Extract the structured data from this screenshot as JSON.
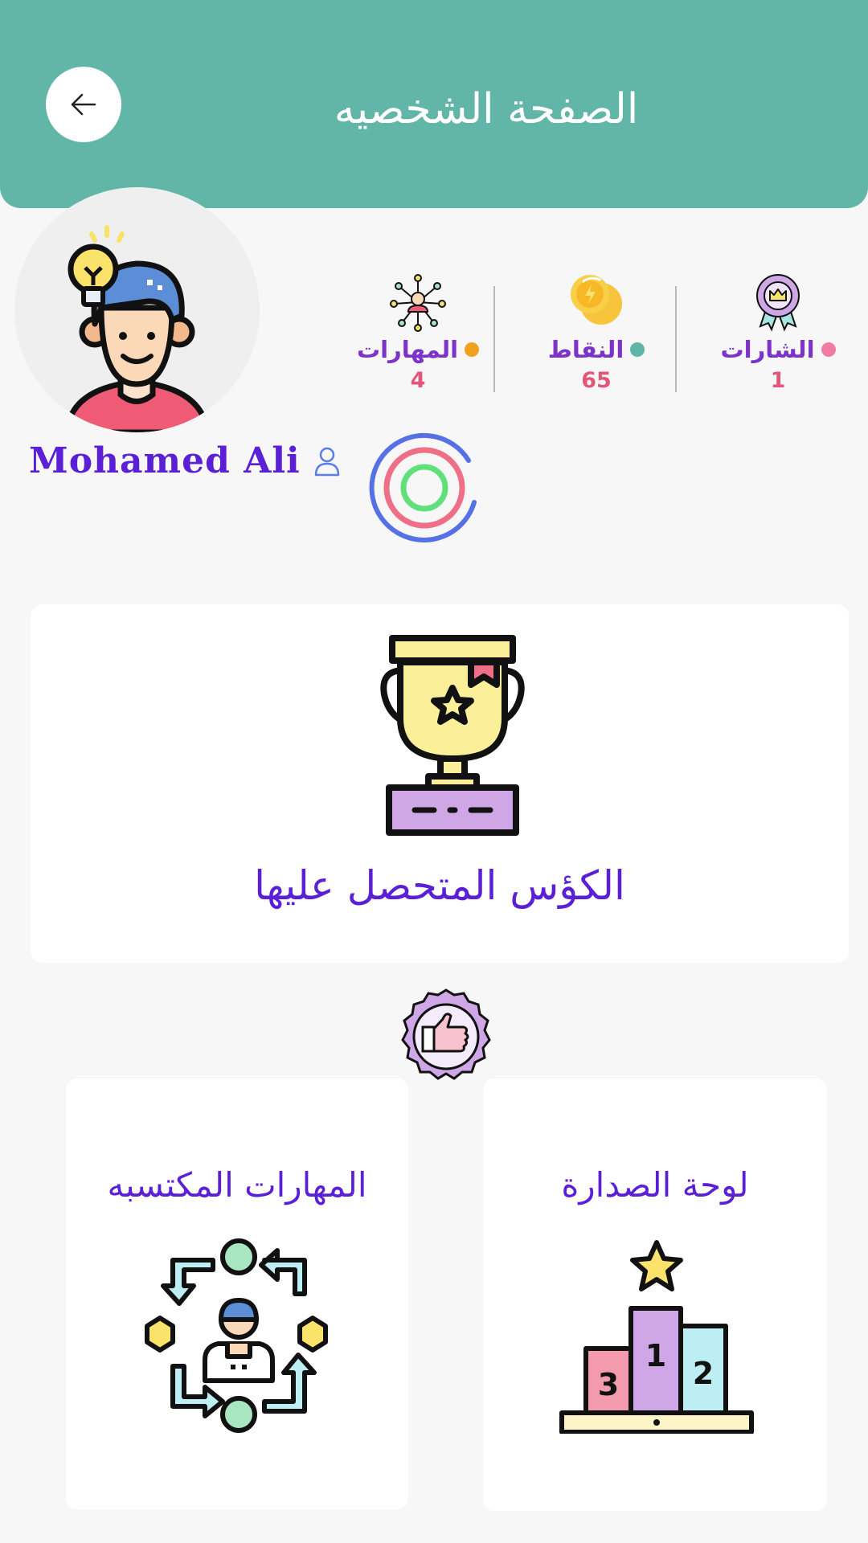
{
  "header": {
    "title": "الصفحة الشخصيه",
    "back_icon": "arrow-left-icon"
  },
  "user": {
    "name": "Mohamed Ali",
    "avatar_icon": "boy-lightbulb-avatar",
    "profile_icon": "person-outline-icon"
  },
  "stats": [
    {
      "label": "الشارات",
      "value": "1",
      "dot_color": "#f27ba5",
      "icon": "medal-crown-icon"
    },
    {
      "label": "النقاط",
      "value": "65",
      "dot_color": "#5fb5a6",
      "icon": "coins-icon"
    },
    {
      "label": "المهارات",
      "value": "4",
      "dot_color": "#f0a21f",
      "icon": "network-skills-icon"
    }
  ],
  "rings_icon": "activity-rings",
  "cups": {
    "title": "الكؤس المتحصل عليها",
    "icon": "trophy-icon"
  },
  "badge_icon": "thumbs-up-badge-icon",
  "skills_card": {
    "title": "المهارات المكتسبه",
    "icon": "skills-cycle-icon"
  },
  "leaderboard_card": {
    "title": "لوحة الصدارة",
    "icon": "podium-icon"
  },
  "colors": {
    "header": "#62b6a8",
    "accent_text": "#5b1fd6",
    "value_text": "#e3567a"
  }
}
